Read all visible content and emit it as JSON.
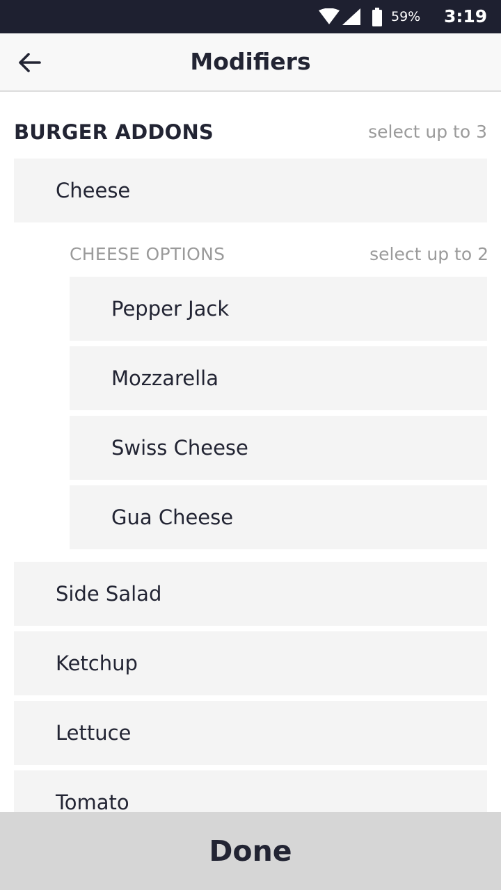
{
  "status_bar": {
    "battery_percent": "59%",
    "time": "3:19",
    "icons": [
      "wifi-icon",
      "cellular-signal-icon",
      "battery-icon"
    ],
    "background_color": "#1e2030"
  },
  "app_bar": {
    "back_icon": "arrow-left-icon",
    "title": "Modifiers"
  },
  "group": {
    "title": "BURGER ADDONS",
    "limit": "select up to 3",
    "items": [
      {
        "label": "Cheese"
      },
      {
        "label": "Side Salad"
      },
      {
        "label": "Ketchup"
      },
      {
        "label": "Lettuce"
      },
      {
        "label": "Tomato"
      }
    ]
  },
  "sub_group": {
    "title": "CHEESE OPTIONS",
    "limit": "select up to 2",
    "items": [
      {
        "label": "Pepper Jack"
      },
      {
        "label": "Mozzarella"
      },
      {
        "label": "Swiss Cheese"
      },
      {
        "label": "Gua Cheese"
      }
    ]
  },
  "footer": {
    "done_label": "Done"
  },
  "colors": {
    "row_background": "#f4f4f4",
    "muted_text": "#9a9a9a",
    "primary_text": "#222433",
    "done_background": "#d6d6d6"
  }
}
